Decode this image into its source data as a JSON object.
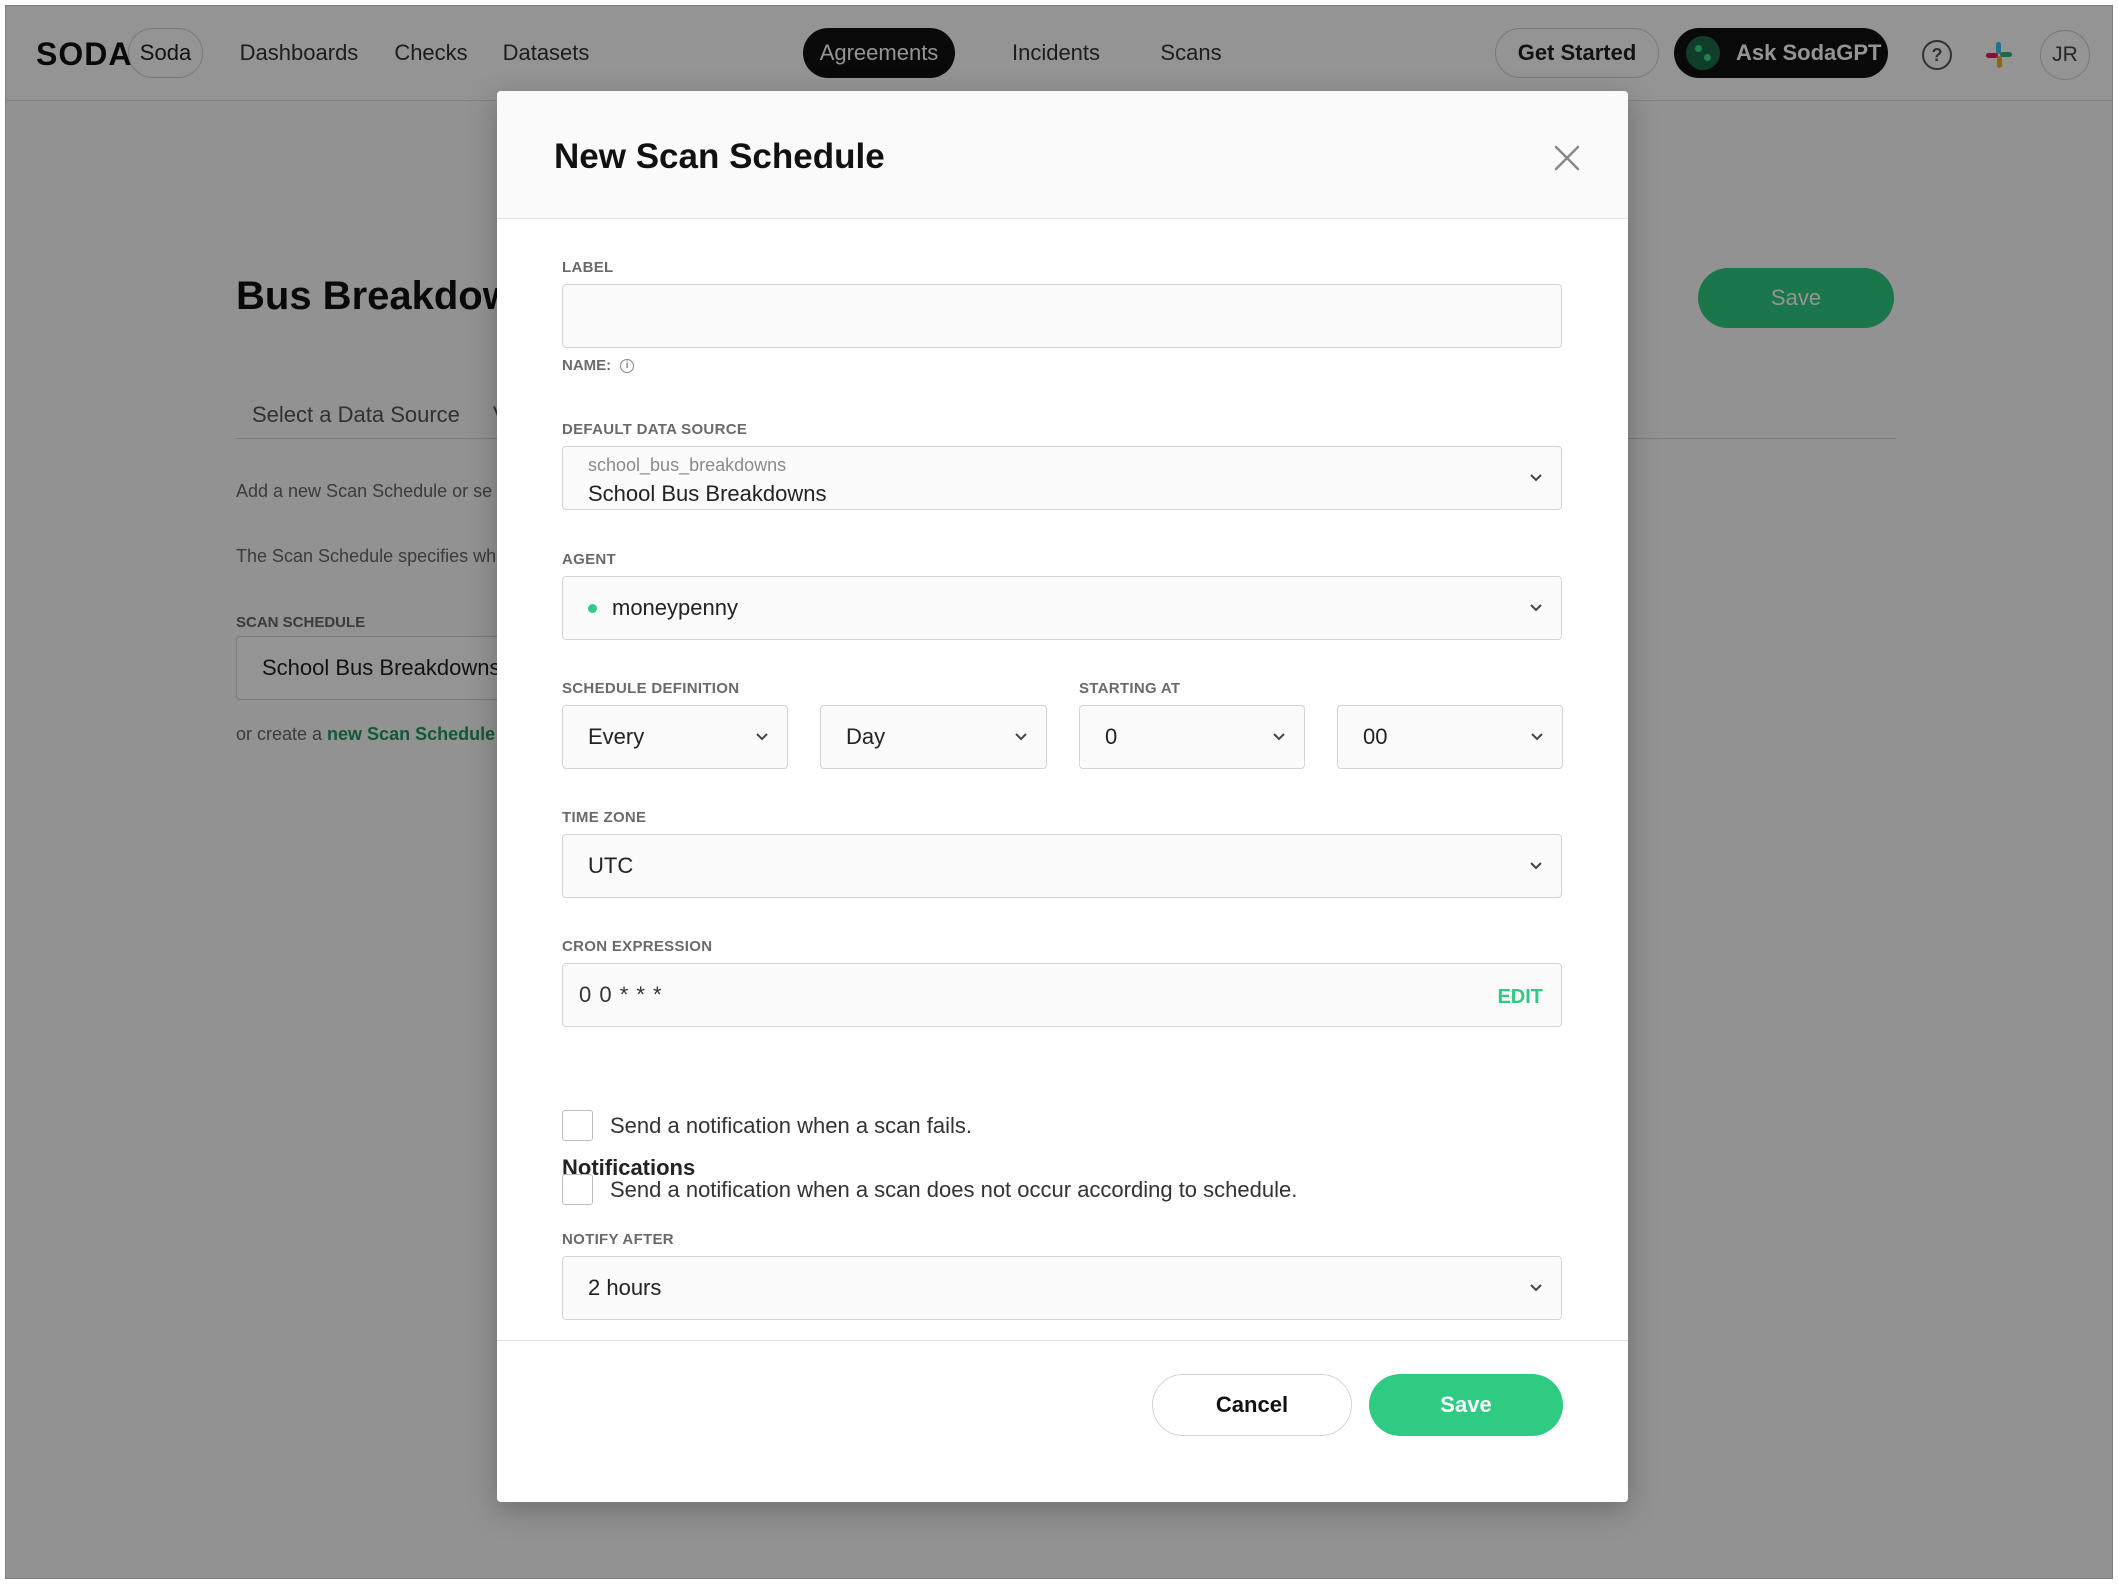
{
  "topbar": {
    "logo_text": "SODA",
    "logo_dots": ":.",
    "org_pill": "Soda",
    "nav": [
      "Dashboards",
      "Checks",
      "Datasets",
      "Agreements",
      "Incidents",
      "Scans"
    ],
    "active_nav": "Agreements",
    "get_started": "Get Started",
    "ask_gpt": "Ask SodaGPT",
    "help_glyph": "?",
    "avatar_initials": "JR",
    "accent_color": "#2fcb82"
  },
  "background_page": {
    "title": "Bus Breakdow",
    "save_label": "Save",
    "tab_select": "Select a Data Source",
    "tab_next_partial": "V",
    "text_1": "Add a new Scan Schedule or se",
    "text_2": "The Scan Schedule specifies wh",
    "scan_schedule_label": "SCAN SCHEDULE",
    "scan_schedule_value": "School Bus Breakdowns",
    "create_prefix": "or create a ",
    "create_link": "new Scan Schedule"
  },
  "modal": {
    "title": "New Scan Schedule",
    "label_field": {
      "label": "LABEL",
      "value": "",
      "name_hint": "NAME:"
    },
    "data_source": {
      "label": "DEFAULT DATA SOURCE",
      "sub_value": "school_bus_breakdowns",
      "value": "School Bus Breakdowns"
    },
    "agent": {
      "label": "AGENT",
      "value": "moneypenny",
      "status": "online"
    },
    "schedule": {
      "label": "SCHEDULE DEFINITION",
      "frequency": "Every",
      "unit": "Day"
    },
    "starting_at": {
      "label": "STARTING AT",
      "hour": "0",
      "minute": "00"
    },
    "timezone": {
      "label": "TIME ZONE",
      "value": "UTC"
    },
    "cron": {
      "label": "CRON EXPRESSION",
      "value": "0 0 * * *",
      "edit_label": "EDIT"
    },
    "notifications": {
      "title": "Notifications",
      "option_fail": "Send a notification when a scan fails.",
      "option_missed": "Send a notification when a scan does not occur according to schedule.",
      "notify_after_label": "NOTIFY AFTER",
      "notify_after_value": "2 hours"
    },
    "footer": {
      "cancel_label": "Cancel",
      "save_label": "Save"
    }
  }
}
